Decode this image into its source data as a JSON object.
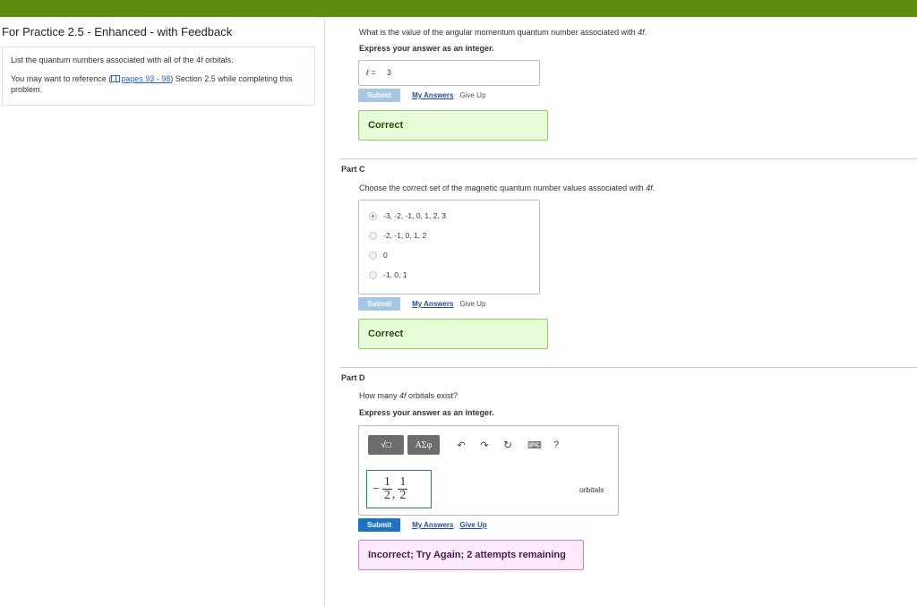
{
  "assignment_title": "For Practice 2.5 - Enhanced - with Feedback",
  "intro": {
    "instruction": "List the quantum numbers associated with all of the 4f orbitals.",
    "ref_prefix": "You may want to reference (",
    "ref_link": "pages 93 - 98",
    "ref_suffix": ") Section 2.5 while completing this problem."
  },
  "part_b": {
    "question_prefix": "What is the value of the angular momentum quantum number associated with ",
    "question_var": "4f",
    "question_suffix": ".",
    "express": "Express your answer as an integer.",
    "answer_label": "ℓ =",
    "answer_value": "3",
    "submit_label": "Submit",
    "my_answers_label": "My Answers",
    "give_up_label": "Give Up",
    "feedback": "Correct"
  },
  "part_c": {
    "label": "Part C",
    "question_prefix": "Choose the correct set of the magnetic quantum number values associated with ",
    "question_var": "4f",
    "question_suffix": ".",
    "options": [
      "-3, -2, -1, 0, 1, 2, 3",
      "-2, -1, 0, 1, 2",
      "0",
      "-1, 0, 1"
    ],
    "selected_index": 0,
    "submit_label": "Submit",
    "my_answers_label": "My Answers",
    "give_up_label": "Give Up",
    "feedback": "Correct"
  },
  "part_d": {
    "label": "Part D",
    "question_prefix": "How many ",
    "question_var": "4f",
    "question_suffix": " orbitals exist?",
    "express": "Express your answer as an integer.",
    "toolbar": {
      "templates_label": "√□",
      "symbols_label": "ΑΣφ",
      "undo": "↶",
      "redo": "↷",
      "reset": "↻",
      "keyboard": "⌨",
      "help": "?"
    },
    "answer": {
      "sign": "−",
      "frac1_num": "1",
      "frac1_den": "2",
      "comma": ",",
      "frac2_num": "1",
      "frac2_den": "2"
    },
    "unit": "orbitals",
    "submit_label": "Submit",
    "my_answers_label": "My Answers",
    "give_up_label": "Give Up",
    "feedback": "Incorrect; Try Again; 2 attempts remaining"
  }
}
